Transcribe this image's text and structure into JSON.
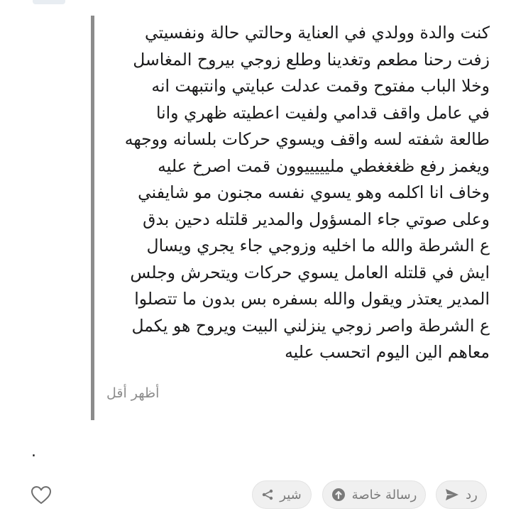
{
  "comment": {
    "lines": [
      "كنت والدة وولدي في العناية وحالتي حالة ونفسيتي",
      "زفت رحنا مطعم وتغدينا وطلع زوجي بيروح المغاسل",
      "وخلا الباب مفتوح وقمت عدلت عبايتي وانتبهت انه",
      "في عامل واقف قدامي ولفيت اعطيته ظهري وانا",
      "طالعة شفته لسه واقف ويسوي حركات بلسانه ووجهه",
      "ويغمز رفع ظغغغطي مليييييوون قمت اصرخ عليه",
      "وخاف انا اكلمه وهو يسوي نفسه مجنون مو شايفني",
      "وعلى صوتي جاء المسؤول والمدير قلتله دحين بدق",
      "ع الشرطة والله ما اخليه وزوجي جاء يجري ويسال",
      "ايش في قلتله العامل يسوي حركات ويتحرش وجلس",
      "المدير يعتذر ويقول والله بسفره بس بدون ما تتصلوا",
      "ع الشرطة واصر زوجي ينزلني البيت ويروح هو يكمل",
      "معاهم الين اليوم اتحسب عليه"
    ],
    "show_less": "أظهر أقل",
    "dot": "."
  },
  "actions": {
    "reply": {
      "label": "رد",
      "icon": "send-icon"
    },
    "private_message": {
      "label": "رسالة خاصة",
      "icon": "arrow-up-circle-icon"
    },
    "share": {
      "label": "شير",
      "icon": "share-icon"
    },
    "like": {
      "icon": "heart-icon"
    }
  },
  "colors": {
    "quote_bar": "#8c8c8c",
    "muted_text": "#8d8d8d",
    "button_bg": "#f0f0f0",
    "text": "#1a1a1b"
  }
}
